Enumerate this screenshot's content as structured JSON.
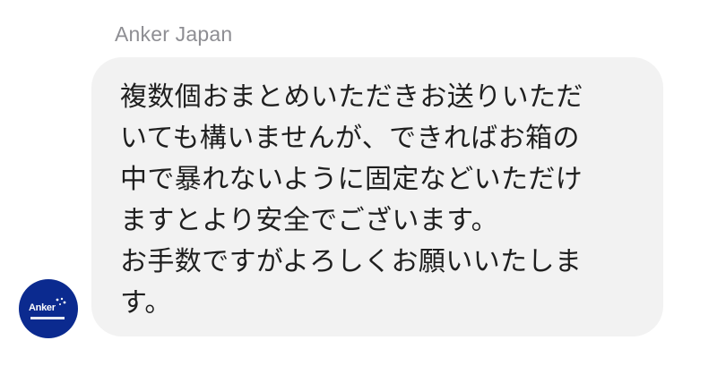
{
  "message": {
    "sender_name": "Anker Japan",
    "lines": [
      "複数個おまとめいただきお送りいただ",
      "いても構いませんが、できればお箱の",
      "中で暴れないように固定などいただけ",
      "ますとより安全でございます。",
      "お手数ですがよろしくお願いいたしま",
      "す。"
    ]
  },
  "avatar": {
    "brand_text": "Anker",
    "background_color": "#0b2a8f"
  },
  "colors": {
    "bubble_background": "#f2f2f2",
    "sender_name": "#8e8e93",
    "message_text": "#1f1f1f"
  }
}
